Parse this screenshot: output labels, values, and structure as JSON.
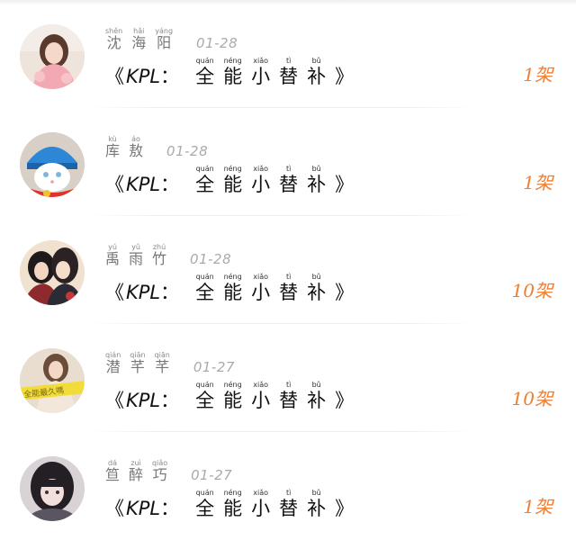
{
  "title_parts": {
    "open": "《",
    "kpl": "KPL",
    "colon": "：",
    "close": "》",
    "chars": [
      {
        "py": "quán",
        "hz": "全"
      },
      {
        "py": "néng",
        "hz": "能"
      },
      {
        "py": "xiǎo",
        "hz": "小"
      },
      {
        "py": "tì",
        "hz": "替"
      },
      {
        "py": "bǔ",
        "hz": "补"
      }
    ]
  },
  "rows": [
    {
      "name": [
        {
          "py": "shěn",
          "hz": "沈"
        },
        {
          "py": "hǎi",
          "hz": "海"
        },
        {
          "py": "yáng",
          "hz": "阳"
        }
      ],
      "date": "01-28",
      "count": "1架",
      "avatar": "girl-pink-sweater"
    },
    {
      "name": [
        {
          "py": "kù",
          "hz": "库"
        },
        {
          "py": "áo",
          "hz": "敖"
        }
      ],
      "date": "01-28",
      "count": "1架",
      "avatar": "cat-blue-hat"
    },
    {
      "name": [
        {
          "py": "yú",
          "hz": "禹"
        },
        {
          "py": "yǔ",
          "hz": "雨"
        },
        {
          "py": "zhú",
          "hz": "竹"
        }
      ],
      "date": "01-28",
      "count": "10架",
      "avatar": "anime-couple"
    },
    {
      "name": [
        {
          "py": "qián",
          "hz": "潜"
        },
        {
          "py": "qiān",
          "hz": "芊"
        },
        {
          "py": "qiān",
          "hz": "芊"
        }
      ],
      "date": "01-27",
      "count": "10架",
      "avatar": "girl-yellow-banner",
      "avatar_text": "全能最久嗎"
    },
    {
      "name": [
        {
          "py": "dá",
          "hz": "笪"
        },
        {
          "py": "zuì",
          "hz": "醉"
        },
        {
          "py": "qiǎo",
          "hz": "巧"
        }
      ],
      "date": "01-27",
      "count": "1架",
      "avatar": "girl-dark-hair"
    }
  ],
  "colors": {
    "count": "#f07e2c",
    "name": "#777777",
    "date": "#aaaaaa",
    "title": "#111111"
  }
}
